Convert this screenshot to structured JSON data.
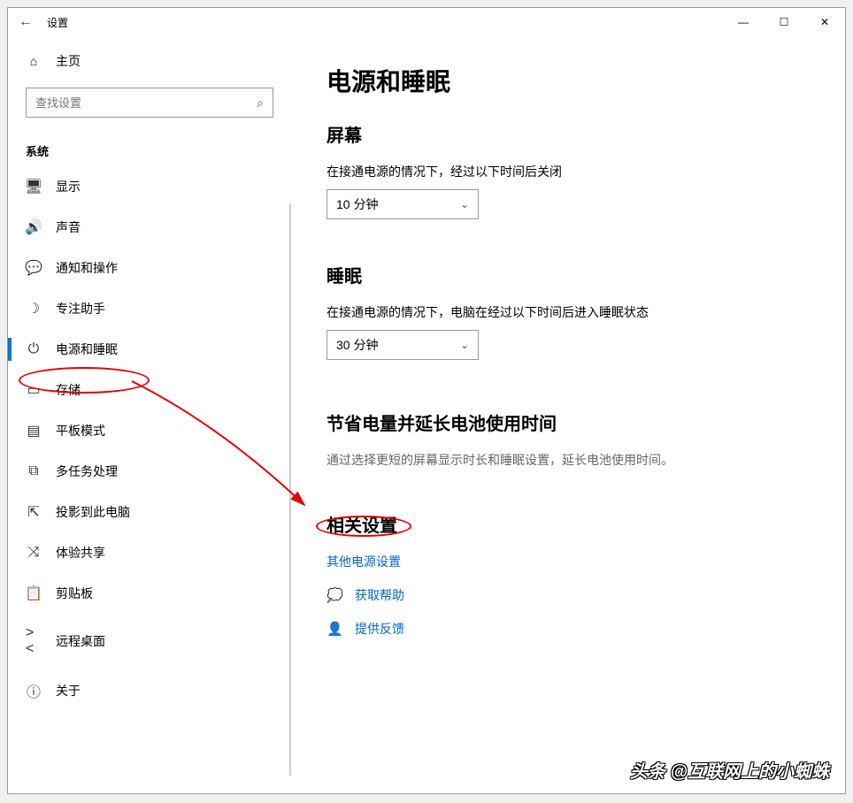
{
  "titlebar": {
    "title": "设置"
  },
  "sidebar": {
    "home": "主页",
    "search_placeholder": "查找设置",
    "section": "系统",
    "items": [
      {
        "icon": "display",
        "label": "显示"
      },
      {
        "icon": "sound",
        "label": "声音"
      },
      {
        "icon": "notify",
        "label": "通知和操作"
      },
      {
        "icon": "focus",
        "label": "专注助手"
      },
      {
        "icon": "power",
        "label": "电源和睡眠",
        "active": true
      },
      {
        "icon": "storage",
        "label": "存储"
      },
      {
        "icon": "tablet",
        "label": "平板模式"
      },
      {
        "icon": "multitask",
        "label": "多任务处理"
      },
      {
        "icon": "project",
        "label": "投影到此电脑"
      },
      {
        "icon": "share",
        "label": "体验共享"
      },
      {
        "icon": "clipboard",
        "label": "剪贴板"
      },
      {
        "icon": "remote",
        "label": "远程桌面"
      },
      {
        "icon": "about",
        "label": "关于"
      }
    ]
  },
  "content": {
    "title": "电源和睡眠",
    "screen": {
      "heading": "屏幕",
      "label": "在接通电源的情况下，经过以下时间后关闭",
      "value": "10 分钟"
    },
    "sleep": {
      "heading": "睡眠",
      "label": "在接通电源的情况下，电脑在经过以下时间后进入睡眠状态",
      "value": "30 分钟"
    },
    "battery": {
      "heading": "节省电量并延长电池使用时间",
      "text": "通过选择更短的屏幕显示时长和睡眠设置，延长电池使用时间。"
    },
    "related": {
      "heading": "相关设置",
      "link": "其他电源设置"
    },
    "help": {
      "get_help": "获取帮助",
      "feedback": "提供反馈"
    }
  },
  "watermark": "头条 @互联网上的小蜘蛛"
}
